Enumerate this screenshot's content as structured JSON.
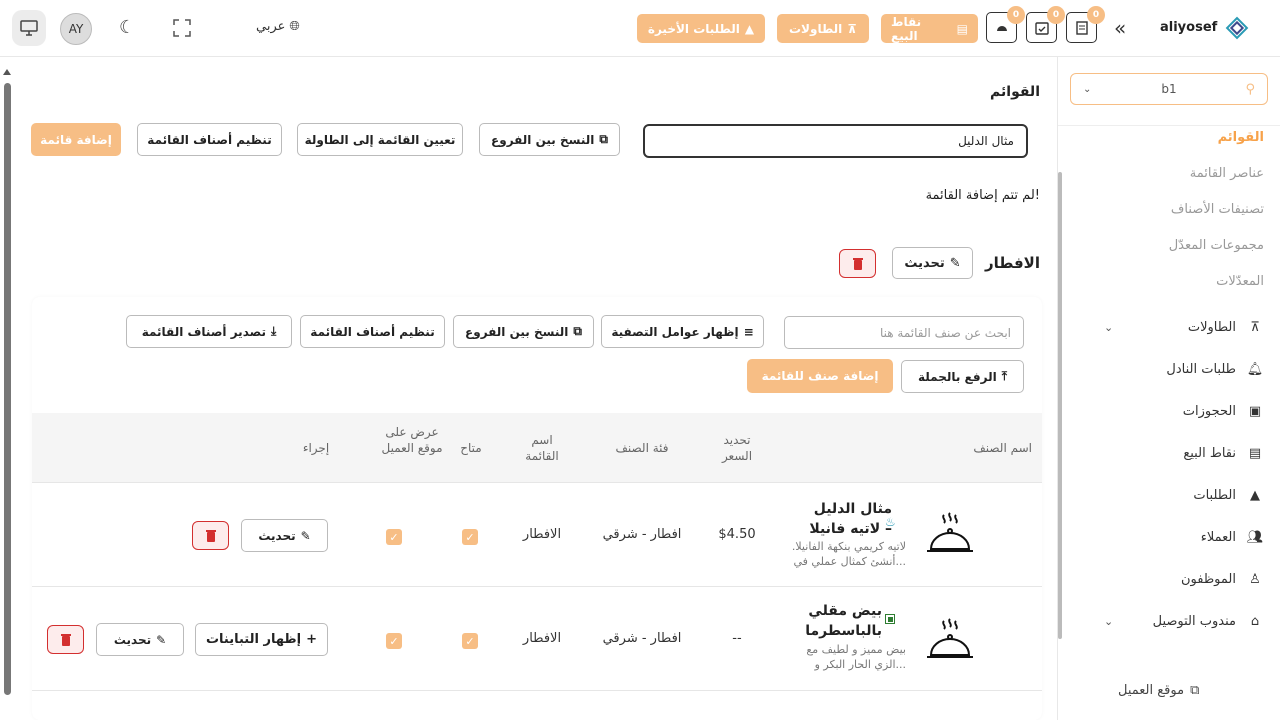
{
  "header": {
    "brand": "aliyosef",
    "recent_orders": "الطلبات الأخيرة",
    "tables": "الطاولات",
    "pos": "نقاط البيع",
    "badge1": "0",
    "badge2": "0",
    "badge3": "0",
    "language": "عربي",
    "avatar": "AY"
  },
  "sidebar": {
    "branch": "b1",
    "menus": "القوائم",
    "menu_items": "عناصر القائمة",
    "categories": "تصنيفات الأصناف",
    "modifier_groups": "مجموعات المعدّل",
    "modifiers": "المعدّلات",
    "tables": "الطاولات",
    "waiter_requests": "طلبات النادل",
    "reservations": "الحجوزات",
    "pos": "نقاط البيع",
    "orders": "الطلبات",
    "customers": "العملاء",
    "staff": "الموظفون",
    "delivery": "مندوب التوصيل",
    "customer_site": "موقع العميل"
  },
  "main": {
    "title": "القوائم",
    "search_value": "مثال الدليل",
    "copy_branches": "النسخ بين الفروع",
    "assign_table": "تعيين القائمة إلى الطاولة",
    "arrange_categories": "تنظيم أصناف القائمة",
    "add_menu": "إضافة قائمة",
    "no_menu_msg": "لم تتم إضافة القائمة!",
    "menu_name": "الافطار",
    "update": "تحديث",
    "card": {
      "search_placeholder": "ابحث عن صنف القائمة هنا",
      "show_filters": "إظهار عوامل التصفية",
      "copy_branches": "النسخ بين الفروع",
      "arrange_categories": "تنظيم أصناف القائمة",
      "export_categories": "تصدير أصناف القائمة",
      "bulk_upload": "الرفع بالجملة",
      "add_item": "إضافة صنف للقائمة"
    },
    "table": {
      "headers": {
        "item_name": "اسم الصنف",
        "price": "تحديد السعر",
        "category": "فئة الصنف",
        "menu_name": "اسم القائمة",
        "available": "متاح",
        "show_site": "عرض على موقع العميل",
        "action": "إجراء"
      },
      "rows": [
        {
          "name": "مثال الدليل – لاتيه فانيلا",
          "desc": "لاتيه كريمي بنكهة الفانيلا. أنشئ كمثال عملي في...",
          "price": "$4.50",
          "category": "افطار - شرقي",
          "menu": "الافطار",
          "update": "تحديث"
        },
        {
          "name": "بيض مقلي بالباسطرما",
          "desc": "بيض مميز و لطيف مع الزي الحار البكر و...",
          "price": "--",
          "category": "افطار - شرقي",
          "menu": "الافطار",
          "variants": "إظهار التباينات",
          "update": "تحديث"
        }
      ]
    }
  }
}
